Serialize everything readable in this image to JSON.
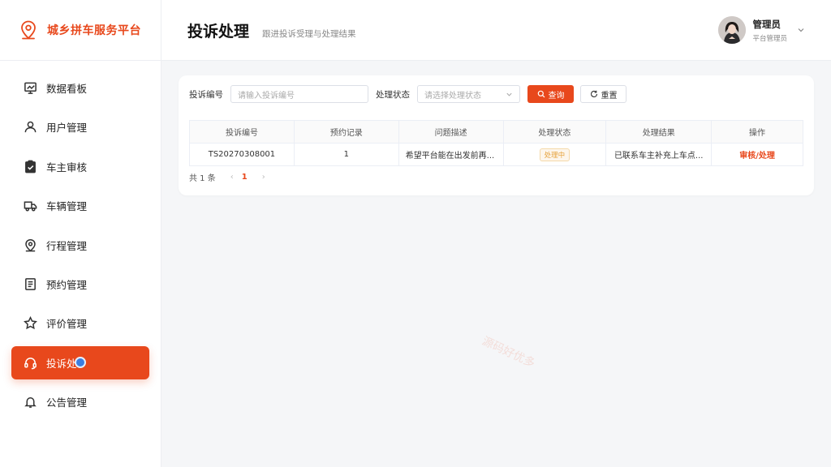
{
  "brand": {
    "title": "城乡拼车服务平台"
  },
  "nav": [
    {
      "label": "数据看板",
      "icon": "chart-board-icon"
    },
    {
      "label": "用户管理",
      "icon": "user-icon"
    },
    {
      "label": "车主审核",
      "icon": "clipboard-check-icon"
    },
    {
      "label": "车辆管理",
      "icon": "truck-icon"
    },
    {
      "label": "行程管理",
      "icon": "location-pin-icon"
    },
    {
      "label": "预约管理",
      "icon": "document-icon"
    },
    {
      "label": "评价管理",
      "icon": "star-icon"
    },
    {
      "label": "投诉处",
      "icon": "headset-icon",
      "active": true
    },
    {
      "label": "公告管理",
      "icon": "bell-icon"
    }
  ],
  "header": {
    "title": "投诉处理",
    "subtitle": "跟进投诉受理与处理结果"
  },
  "user": {
    "name": "管理员",
    "role": "平台管理员"
  },
  "filter": {
    "id_label": "投诉编号",
    "id_placeholder": "请输入投诉编号",
    "status_label": "处理状态",
    "status_placeholder": "请选择处理状态",
    "search_label": "查询",
    "reset_label": "重置"
  },
  "table": {
    "columns": [
      "投诉编号",
      "预约记录",
      "问题描述",
      "处理状态",
      "处理结果",
      "操作"
    ],
    "rows": [
      {
        "id": "TS20270308001",
        "booking": "1",
        "desc": "希望平台能在出发前再...",
        "status": "处理中",
        "result": "已联系车主补充上车点...",
        "action": "审核/处理"
      }
    ]
  },
  "pager": {
    "total": "共 1 条",
    "current": "1"
  },
  "watermark": "源码好优多",
  "colors": {
    "accent": "#e8481c"
  }
}
